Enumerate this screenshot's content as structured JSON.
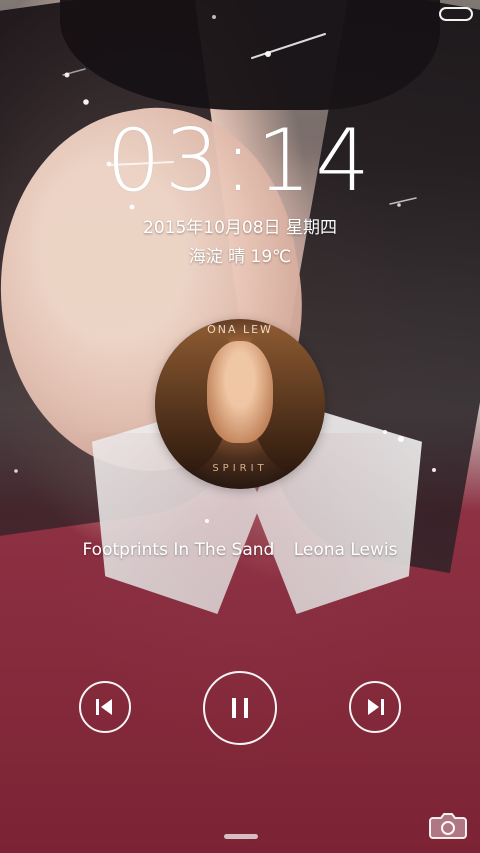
{
  "clock": {
    "time": "03:14"
  },
  "lockscreen": {
    "date": "2015年10月08日  星期四",
    "weather": "海淀 晴 19℃"
  },
  "media": {
    "track_title": "Footprints In The Sand",
    "artist": "Leona Lewis",
    "album_cover_top_text": "ONA LEW",
    "album_cover_bottom_text": "SPIRIT"
  },
  "icons": {
    "status": "battery-icon",
    "previous": "previous-track-icon",
    "pause": "pause-icon",
    "next": "next-track-icon",
    "camera": "camera-icon"
  }
}
